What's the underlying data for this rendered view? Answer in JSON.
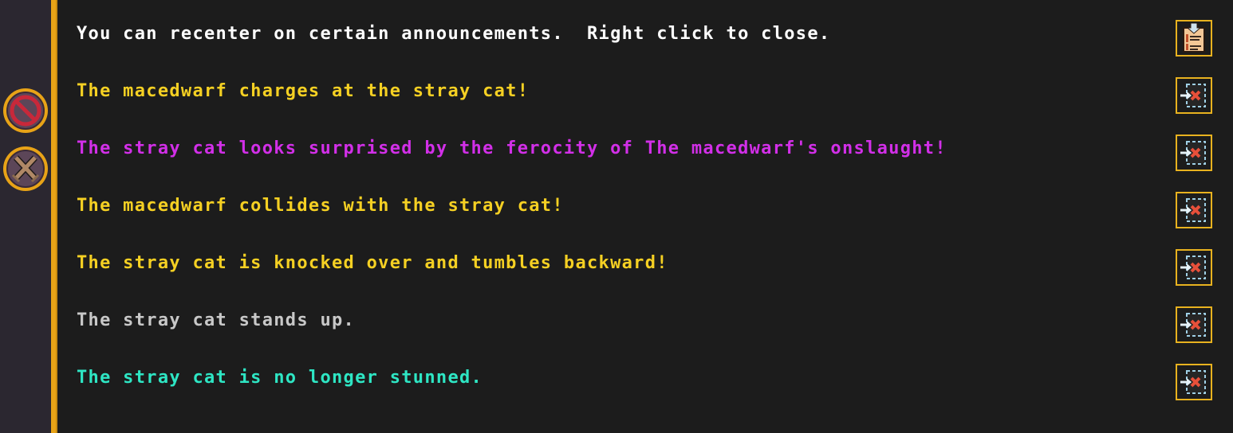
{
  "sidebar": {
    "buttons": [
      {
        "name": "cancel-icon",
        "label": "cancel"
      },
      {
        "name": "crossed-swords-icon",
        "label": "combat"
      }
    ]
  },
  "announcements": [
    {
      "text": "You can recenter on certain announcements.  Right click to close.",
      "color": "#ffffff",
      "button_icon": "clipboard-icon"
    },
    {
      "text": "The macedwarf charges at the stray cat!",
      "color": "#f5d023",
      "button_icon": "recenter-icon"
    },
    {
      "text": "The stray cat looks surprised by the ferocity of The macedwarf's onslaught!",
      "color": "#d22fe8",
      "button_icon": "recenter-icon"
    },
    {
      "text": "The macedwarf collides with the stray cat!",
      "color": "#f5d023",
      "button_icon": "recenter-icon"
    },
    {
      "text": "The stray cat is knocked over and tumbles backward!",
      "color": "#f5d023",
      "button_icon": "recenter-icon"
    },
    {
      "text": "The stray cat stands up.",
      "color": "#c8c8c8",
      "button_icon": "recenter-icon"
    },
    {
      "text": "The stray cat is no longer stunned.",
      "color": "#2ee6c4",
      "button_icon": "recenter-icon"
    }
  ],
  "colors": {
    "border_accent": "#e8a317",
    "background": "#1c1c1c"
  }
}
